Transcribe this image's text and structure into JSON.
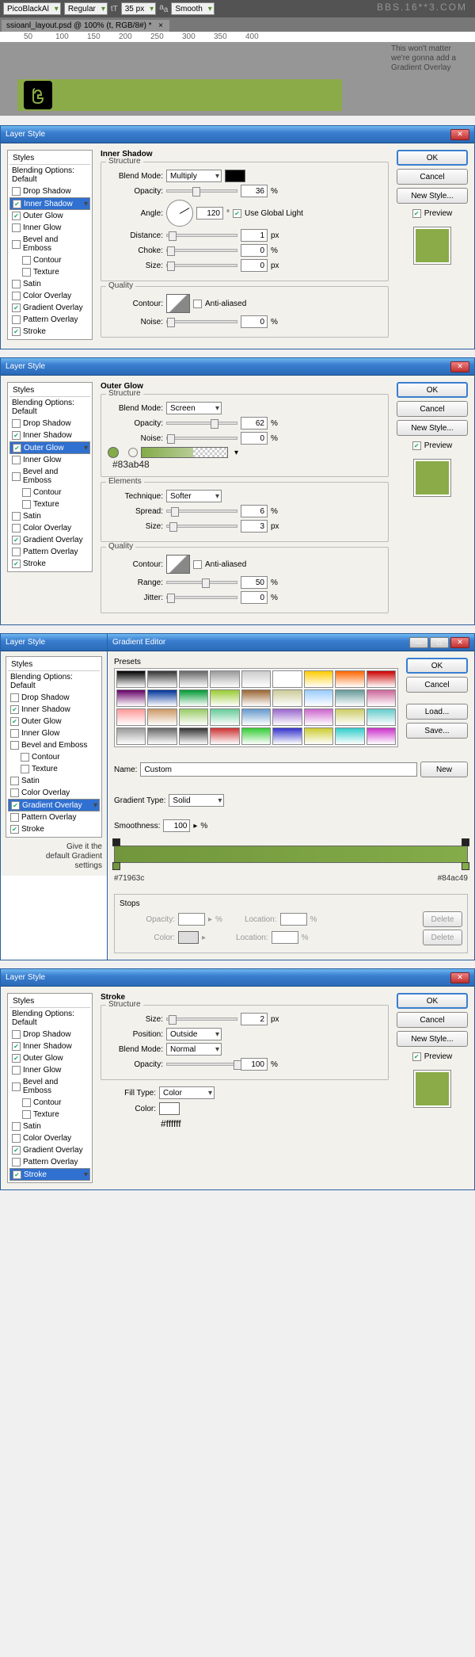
{
  "topbar": {
    "font": "PicoBlackAl",
    "weight": "Regular",
    "size": "35 px",
    "aa": "Smooth"
  },
  "tab": {
    "name": "ssioanl_layout.psd @ 100% (t, RGB/8#) *",
    "close": "×"
  },
  "ruler_marks": [
    "50",
    "100",
    "150",
    "200",
    "250",
    "300",
    "350",
    "400"
  ],
  "watermark": "BBS.16**3.COM",
  "canvas_note": "This won't matter\nwe're gonna add a\nGradient Overlay",
  "arrow_note": "",
  "dialogs": {
    "title": "Layer Style",
    "ok": "OK",
    "cancel": "Cancel",
    "newstyle": "New Style...",
    "preview": "Preview",
    "styles_hdr": "Styles",
    "blend_default": "Blending Options: Default",
    "effects": [
      "Drop Shadow",
      "Inner Shadow",
      "Outer Glow",
      "Inner Glow",
      "Bevel and Emboss",
      "Contour",
      "Texture",
      "Satin",
      "Color Overlay",
      "Gradient Overlay",
      "Pattern Overlay",
      "Stroke"
    ],
    "inner_shadow": {
      "title": "Inner Shadow",
      "structure": "Structure",
      "blend_mode_lbl": "Blend Mode:",
      "blend_mode": "Multiply",
      "opacity_lbl": "Opacity:",
      "opacity": "36",
      "pct": "%",
      "angle_lbl": "Angle:",
      "angle": "120",
      "deg": "°",
      "ugl": "Use Global Light",
      "distance_lbl": "Distance:",
      "distance": "1",
      "px": "px",
      "choke_lbl": "Choke:",
      "choke": "0",
      "size_lbl": "Size:",
      "size": "0",
      "quality": "Quality",
      "contour_lbl": "Contour:",
      "aa": "Anti-aliased",
      "noise_lbl": "Noise:",
      "noise": "0"
    },
    "outer_glow": {
      "title": "Outer Glow",
      "structure": "Structure",
      "blend_mode_lbl": "Blend Mode:",
      "blend_mode": "Screen",
      "opacity_lbl": "Opacity:",
      "opacity": "62",
      "pct": "%",
      "noise_lbl": "Noise:",
      "noise": "0",
      "hex": "#83ab48",
      "elements": "Elements",
      "technique_lbl": "Technique:",
      "technique": "Softer",
      "spread_lbl": "Spread:",
      "spread": "6",
      "size_lbl": "Size:",
      "size": "3",
      "px": "px",
      "quality": "Quality",
      "contour_lbl": "Contour:",
      "aa": "Anti-aliased",
      "range_lbl": "Range:",
      "range": "50",
      "jitter_lbl": "Jitter:",
      "jitter": "0"
    },
    "gradient": {
      "ge_title": "Gradient Editor",
      "presets_lbl": "Presets",
      "name_lbl": "Name:",
      "name": "Custom",
      "new": "New",
      "type_lbl": "Gradient Type:",
      "type": "Solid",
      "smooth_lbl": "Smoothness:",
      "smooth": "100",
      "pct": "%",
      "hex_left": "#71963c",
      "hex_right": "#84ac49",
      "stops": "Stops",
      "opacity_lbl": "Opacity:",
      "location_lbl": "Location:",
      "color_lbl": "Color:",
      "delete": "Delete",
      "load": "Load...",
      "save": "Save...",
      "sidenote": "Give it the\ndefault Gradient\nsettings"
    },
    "stroke": {
      "title": "Stroke",
      "structure": "Structure",
      "size_lbl": "Size:",
      "size": "2",
      "px": "px",
      "position_lbl": "Position:",
      "position": "Outside",
      "blend_mode_lbl": "Blend Mode:",
      "blend_mode": "Normal",
      "opacity_lbl": "Opacity:",
      "opacity": "100",
      "pct": "%",
      "fill_lbl": "Fill Type:",
      "fill": "Color",
      "color_lbl": "Color:",
      "hex": "#ffffff"
    },
    "preset_colors": [
      "#000",
      "#333",
      "#666",
      "#999",
      "#ccc",
      "#fff",
      "#fc0",
      "#f60",
      "#c00",
      "#606",
      "#039",
      "#093",
      "#9c3",
      "#963",
      "#cc9",
      "#9cf",
      "#699",
      "#c69",
      "#f99",
      "#c96",
      "#9c6",
      "#6c9",
      "#69c",
      "#96c",
      "#c6c",
      "#cc6",
      "#6cc",
      "#999",
      "#666",
      "#333",
      "#c33",
      "#3c3",
      "#33c",
      "#cc3",
      "#3cc",
      "#c3c"
    ]
  }
}
